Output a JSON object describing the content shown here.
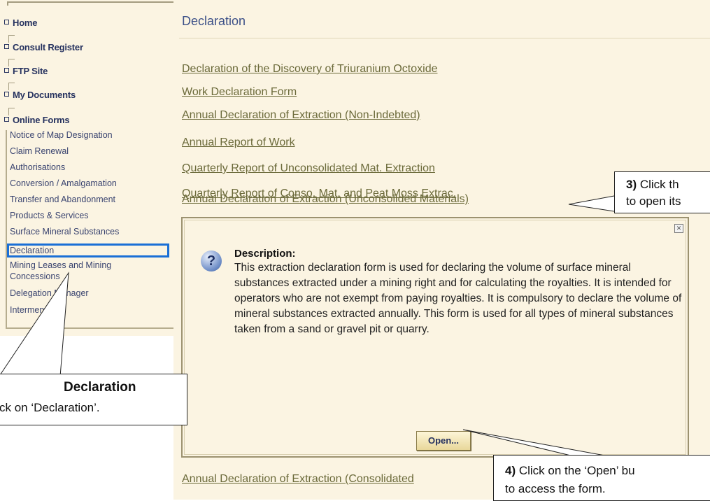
{
  "sidebar": {
    "top_items": [
      {
        "label": "Home"
      },
      {
        "label": "Consult Register"
      },
      {
        "label": "FTP Site"
      },
      {
        "label": "My Documents"
      },
      {
        "label": "Online Forms"
      }
    ],
    "online_forms_items": [
      {
        "label": "Notice of Map Designation"
      },
      {
        "label": "Claim Renewal"
      },
      {
        "label": "Authorisations"
      },
      {
        "label": "Conversion / Amalgamation"
      },
      {
        "label": "Transfer and Abandonment"
      },
      {
        "label": "Products & Services"
      },
      {
        "label": "Surface Mineral Substances"
      },
      {
        "label": "Declaration",
        "selected": true
      },
      {
        "label": "Mining Leases and Mining"
      },
      {
        "label": "Concessions"
      },
      {
        "label": "Delegation Manager"
      },
      {
        "label": "Interment"
      }
    ]
  },
  "main": {
    "title": "Declaration",
    "links": [
      "Declaration of the Discovery of Triuranium Octoxide",
      "Work Declaration Form",
      "Annual Declaration of Extraction (Non-Indebted)",
      "Annual Report of Work",
      "Quarterly Report of Unconsolidated Mat. Extraction",
      "Quarterly Report of Conso. Mat. and Peat Moss Extrac.",
      "Annual Declaration of Extraction (Unconsolided Materials)",
      "Annual Declaration of Extraction (Consolidated"
    ],
    "description": {
      "label": "Description:",
      "text": "This extraction declaration form is used for declaring the volume of surface mineral substances extracted under a mining right and for calculating the royalties. It is intended for operators who are not exempt from paying royalties. It is compulsory to declare the volume of mineral substances extracted annually. This form is used for all types of mineral substances taken from a sand or gravel pit or quarry.",
      "open_button": "Open...",
      "close_glyph": "✕"
    }
  },
  "callouts": {
    "declaration": {
      "title": "Declaration",
      "body": "ck on ‘Declaration’."
    },
    "click_link": {
      "num": "3)",
      "line1_rest": " Click th",
      "line2": "to open its"
    },
    "open_button": {
      "num": "4)",
      "line1_rest": " Click on the ‘Open’ bu",
      "line2": "to access the form."
    }
  },
  "colors": {
    "panel_bg": "#fbf4e2",
    "nav_text": "#26325f",
    "link_text": "#6b6a3a",
    "title_text": "#3d5188",
    "highlight": "#1a6fd6"
  },
  "icons": {
    "help": "question-mark-icon",
    "close": "close-icon"
  }
}
